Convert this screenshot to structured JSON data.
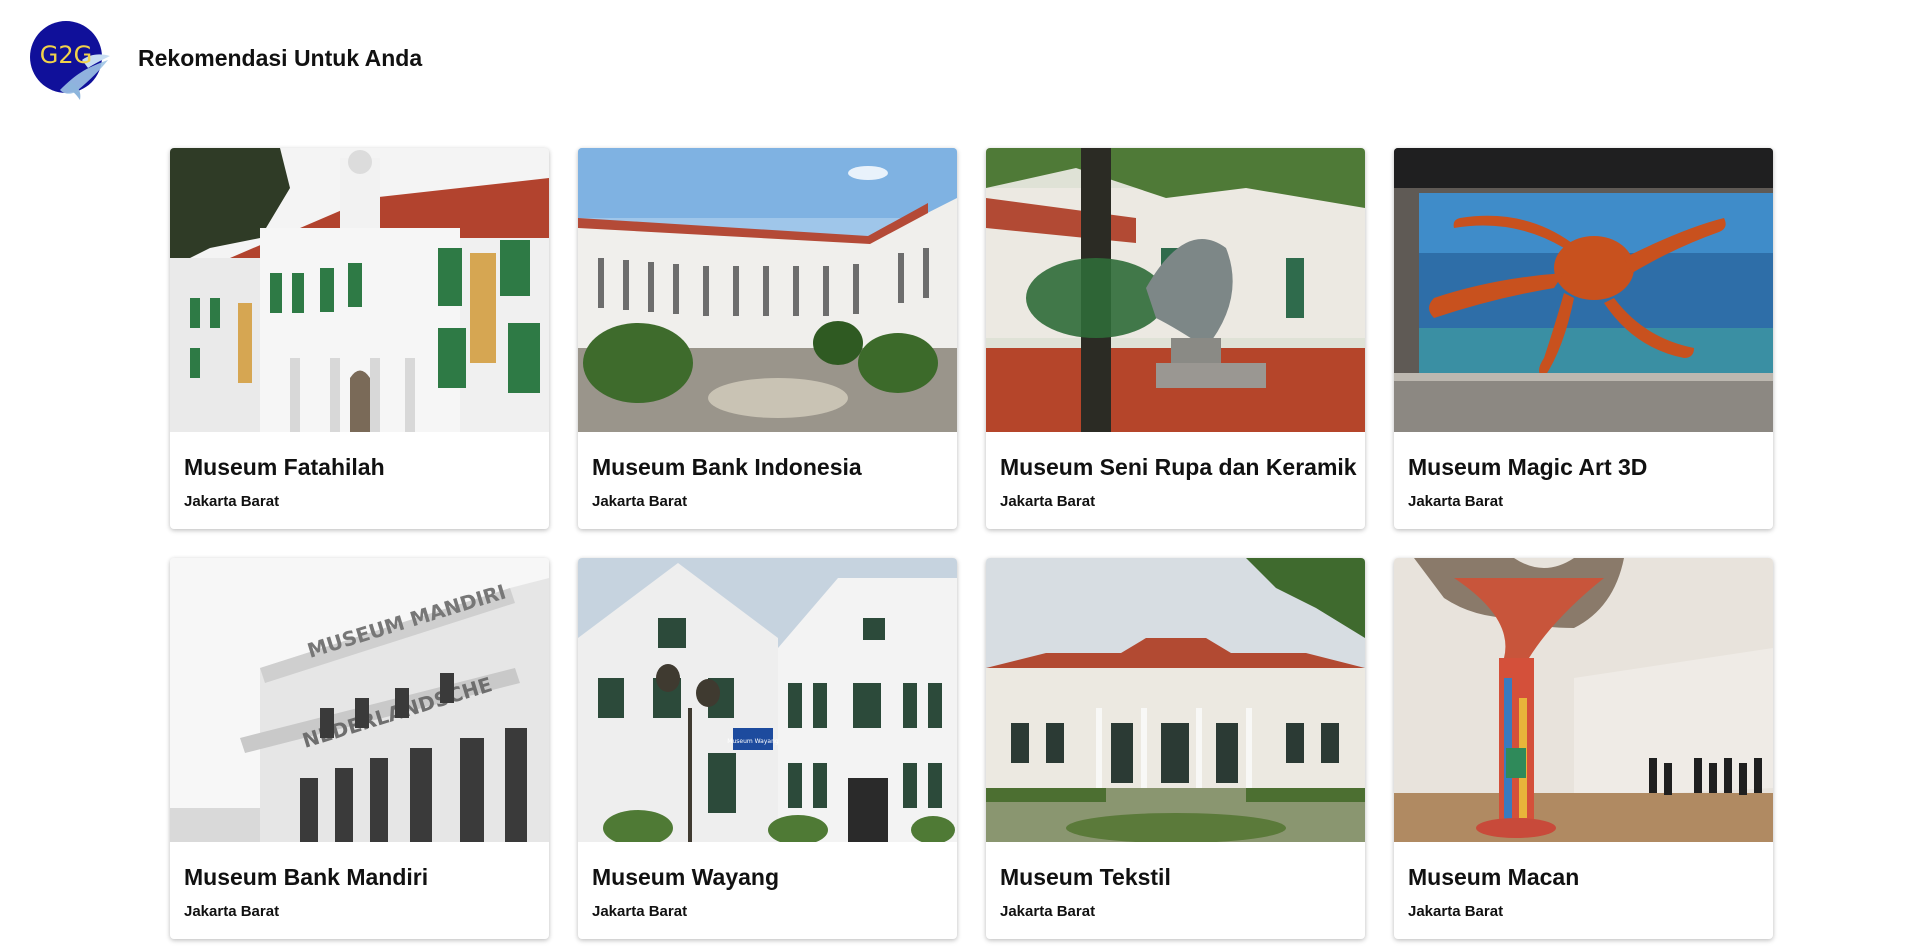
{
  "header": {
    "logo_text": "G2G",
    "title": "Rekomendasi Untuk Anda"
  },
  "cards": [
    {
      "title": "Museum Fatahilah",
      "location": "Jakarta Barat",
      "image": "museum-fatahilah-photo"
    },
    {
      "title": "Museum Bank Indonesia",
      "location": "Jakarta Barat",
      "image": "museum-bank-indonesia-photo"
    },
    {
      "title": "Museum Seni Rupa dan Keramik",
      "location": "Jakarta Barat",
      "image": "museum-seni-rupa-photo"
    },
    {
      "title": "Museum Magic Art 3D",
      "location": "Jakarta Barat",
      "image": "museum-magic-art-photo"
    },
    {
      "title": "Museum Bank Mandiri",
      "location": "Jakarta Barat",
      "image": "museum-bank-mandiri-photo"
    },
    {
      "title": "Museum Wayang",
      "location": "Jakarta Barat",
      "image": "museum-wayang-photo"
    },
    {
      "title": "Museum Tekstil",
      "location": "Jakarta Barat",
      "image": "museum-tekstil-photo"
    },
    {
      "title": "Museum Macan",
      "location": "Jakarta Barat",
      "image": "museum-macan-photo"
    }
  ],
  "image_signs": {
    "bank_mandiri_sign_1": "MUSEUM MANDIRI",
    "bank_mandiri_sign_2": "NEDERLANDSCHE",
    "wayang_sign": "Museum Wayang"
  },
  "colors": {
    "logo_bg": "#10109a",
    "logo_text": "#f1d24a",
    "card_bg": "#ffffff",
    "text": "#111111"
  }
}
